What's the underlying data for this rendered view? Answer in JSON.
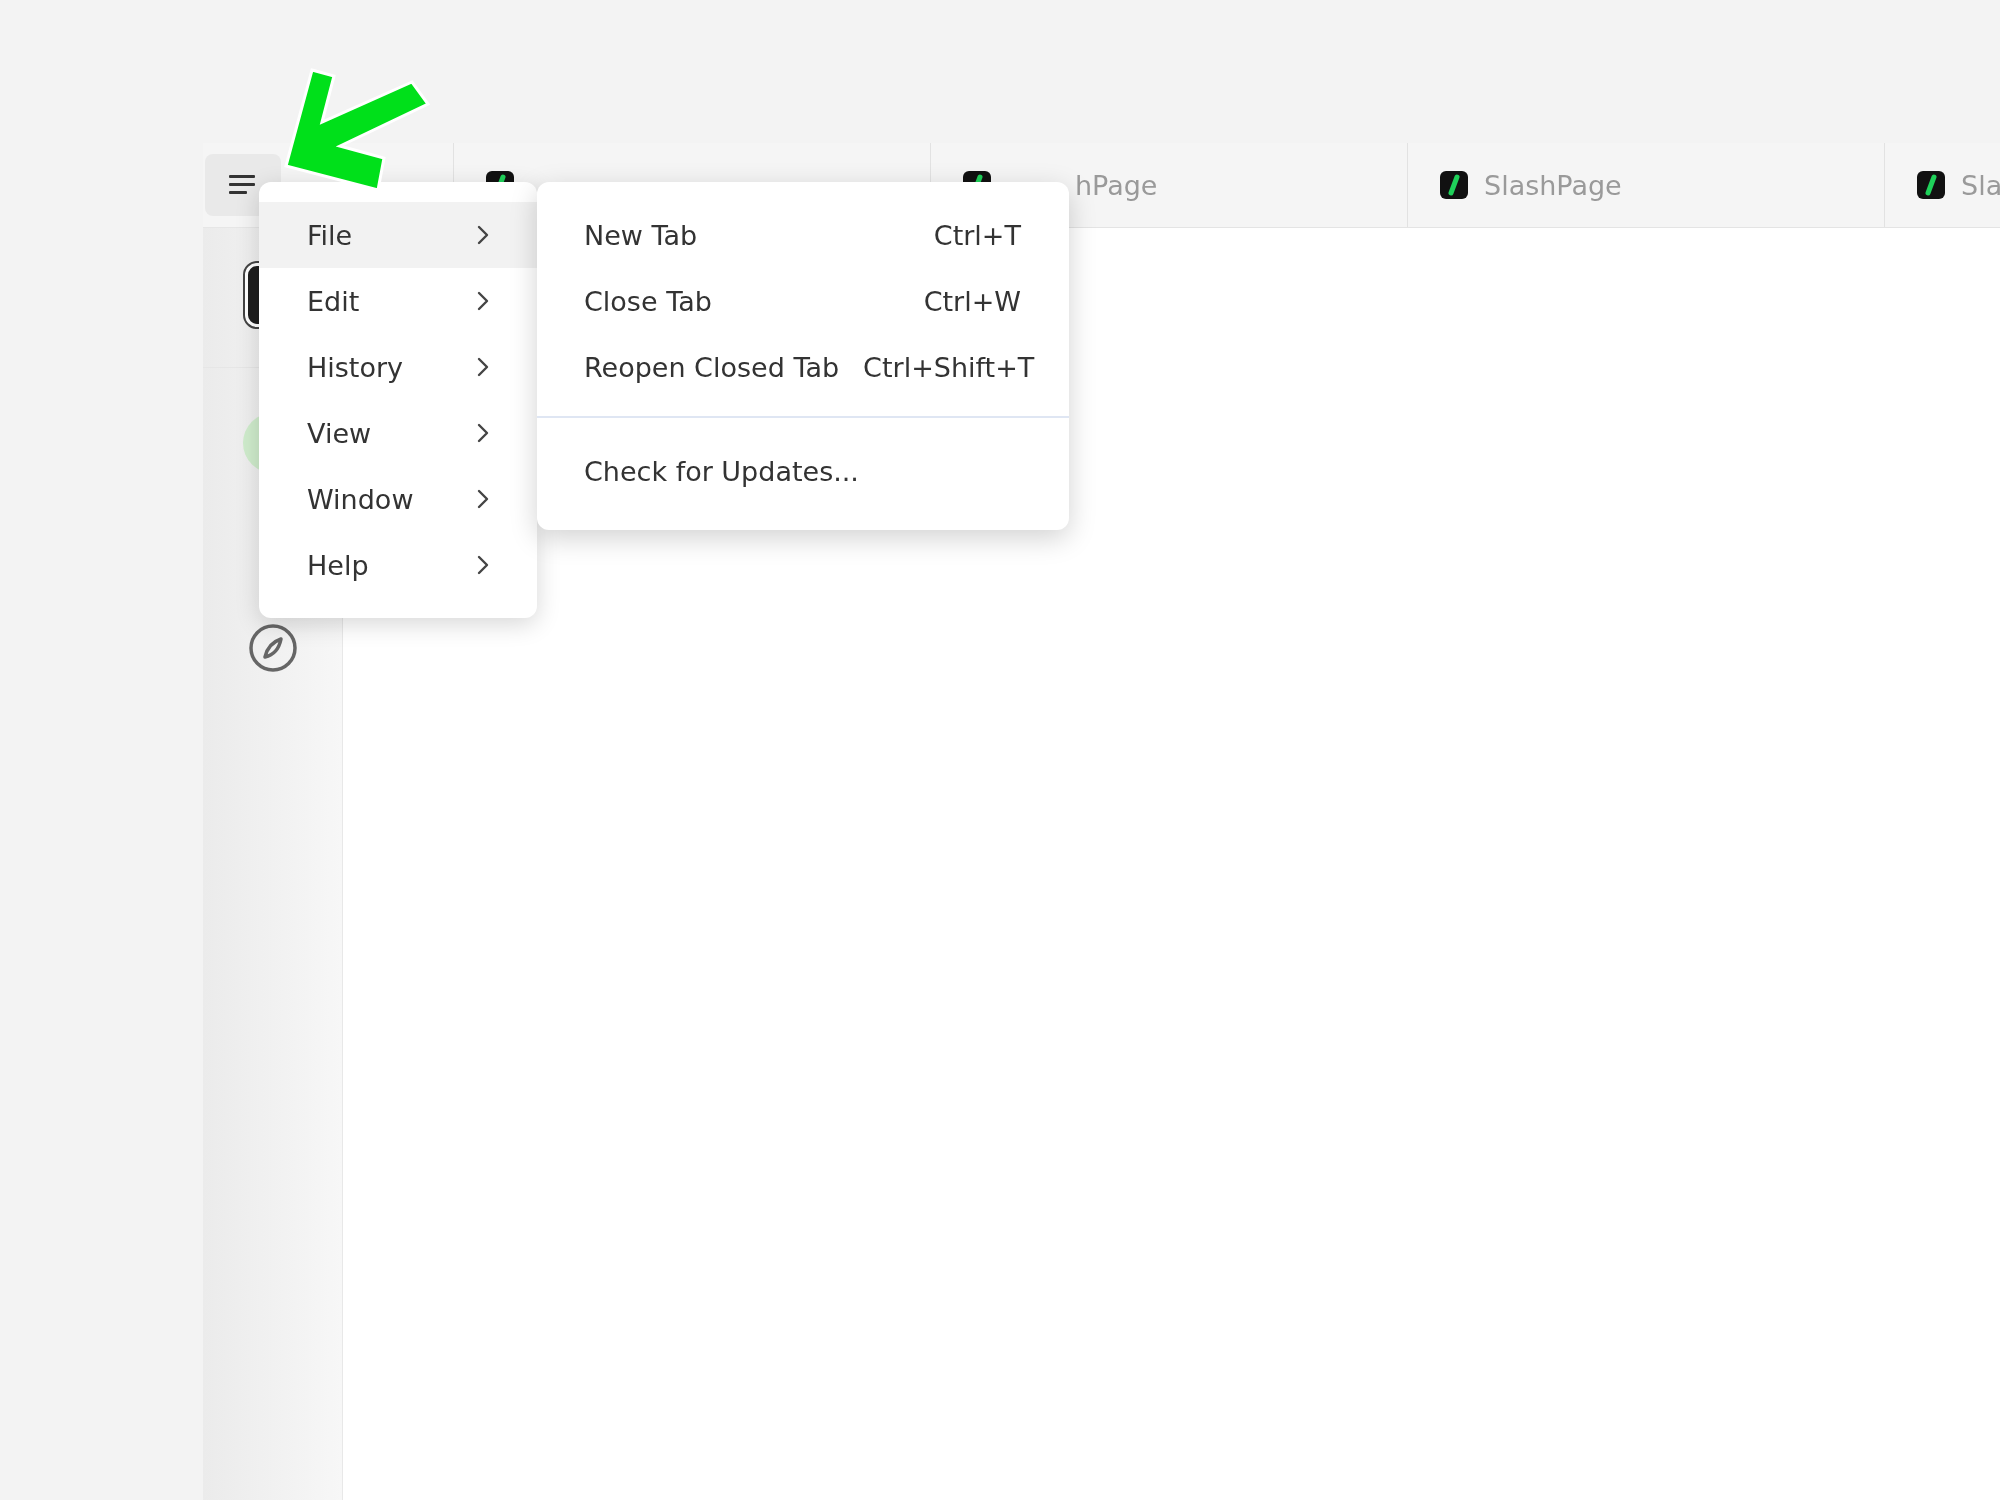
{
  "tabs": [
    {
      "kind": "covered"
    },
    {
      "kind": "cut",
      "label": "hPage"
    },
    {
      "kind": "full",
      "label": "SlashPage"
    },
    {
      "kind": "full",
      "label": "Sla"
    }
  ],
  "menu": {
    "items": [
      {
        "label": "File",
        "selected": true
      },
      {
        "label": "Edit",
        "selected": false
      },
      {
        "label": "History",
        "selected": false
      },
      {
        "label": "View",
        "selected": false
      },
      {
        "label": "Window",
        "selected": false
      },
      {
        "label": "Help",
        "selected": false
      }
    ]
  },
  "submenu": {
    "sections": [
      {
        "items": [
          {
            "label": "New Tab",
            "shortcut": "Ctrl+T"
          },
          {
            "label": "Close Tab",
            "shortcut": "Ctrl+W"
          },
          {
            "label": "Reopen Closed Tab",
            "shortcut": "Ctrl+Shift+T"
          }
        ]
      },
      {
        "items": [
          {
            "label": "Check for Updates..."
          }
        ]
      }
    ]
  }
}
